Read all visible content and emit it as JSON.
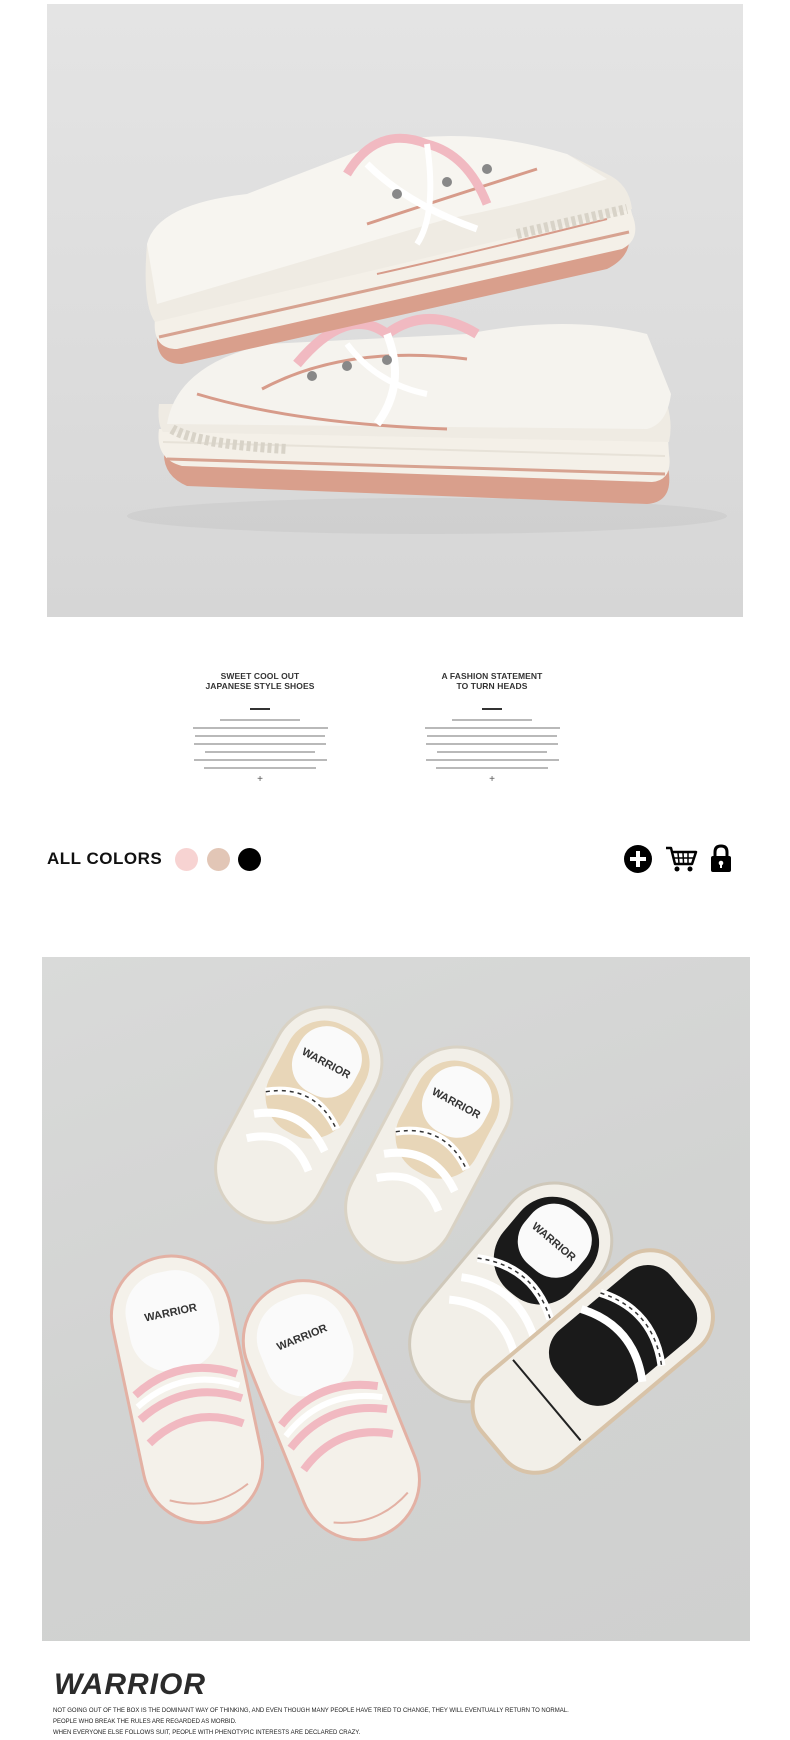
{
  "features": [
    {
      "heading": "SWEET COOL OUT\nJAPANESE STYLE SHOES",
      "plus": "+"
    },
    {
      "heading": "A FASHION STATEMENT\nTO TURN HEADS",
      "plus": "+"
    }
  ],
  "colors_row": {
    "label": "ALL COLORS",
    "swatches": [
      "#f7d3d2",
      "#e2c6b6",
      "#000000"
    ],
    "icons": [
      "plus-circle-icon",
      "shopping-cart-icon",
      "padlock-icon"
    ]
  },
  "brand": {
    "name": "WARRIOR",
    "lines": [
      "NOT GOING OUT OF THE BOX IS THE DOMINANT WAY OF THINKING, AND EVEN THOUGH MANY PEOPLE HAVE TRIED TO CHANGE, THEY WILL EVENTUALLY RETURN TO NORMAL.",
      "PEOPLE WHO BREAK THE RULES ARE REGARDED AS MORBID.",
      "WHEN EVERYONE ELSE FOLLOWS SUIT, PEOPLE WITH PHENOTYPIC INTERESTS ARE DECLARED CRAZY."
    ]
  },
  "insole_print": "WARRIOR"
}
